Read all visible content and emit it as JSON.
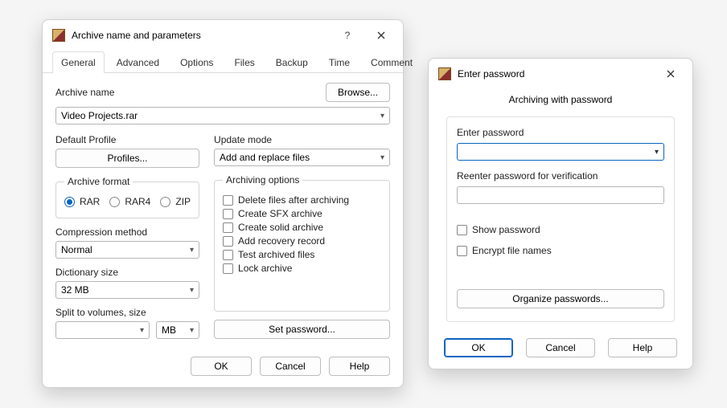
{
  "archiveDialog": {
    "title": "Archive name and parameters",
    "tabs": [
      "General",
      "Advanced",
      "Options",
      "Files",
      "Backup",
      "Time",
      "Comment"
    ],
    "archiveNameLabel": "Archive name",
    "archiveNameValue": "Video Projects.rar",
    "browse": "Browse...",
    "defaultProfileLabel": "Default Profile",
    "profilesBtn": "Profiles...",
    "updateModeLabel": "Update mode",
    "updateModeValue": "Add and replace files",
    "archiveFormatLegend": "Archive format",
    "formats": [
      "RAR",
      "RAR4",
      "ZIP"
    ],
    "formatSelected": "RAR",
    "compressionLabel": "Compression method",
    "compressionValue": "Normal",
    "dictLabel": "Dictionary size",
    "dictValue": "32 MB",
    "splitLabel": "Split to volumes, size",
    "splitUnit": "MB",
    "archOptionsLegend": "Archiving options",
    "options": [
      "Delete files after archiving",
      "Create SFX archive",
      "Create solid archive",
      "Add recovery record",
      "Test archived files",
      "Lock archive"
    ],
    "setPassword": "Set password...",
    "ok": "OK",
    "cancel": "Cancel",
    "help": "Help"
  },
  "pwdDialog": {
    "title": "Enter password",
    "subtitle": "Archiving with password",
    "enterLabel": "Enter password",
    "reenterLabel": "Reenter password for verification",
    "showPwd": "Show password",
    "encryptNames": "Encrypt file names",
    "organize": "Organize passwords...",
    "ok": "OK",
    "cancel": "Cancel",
    "help": "Help"
  }
}
